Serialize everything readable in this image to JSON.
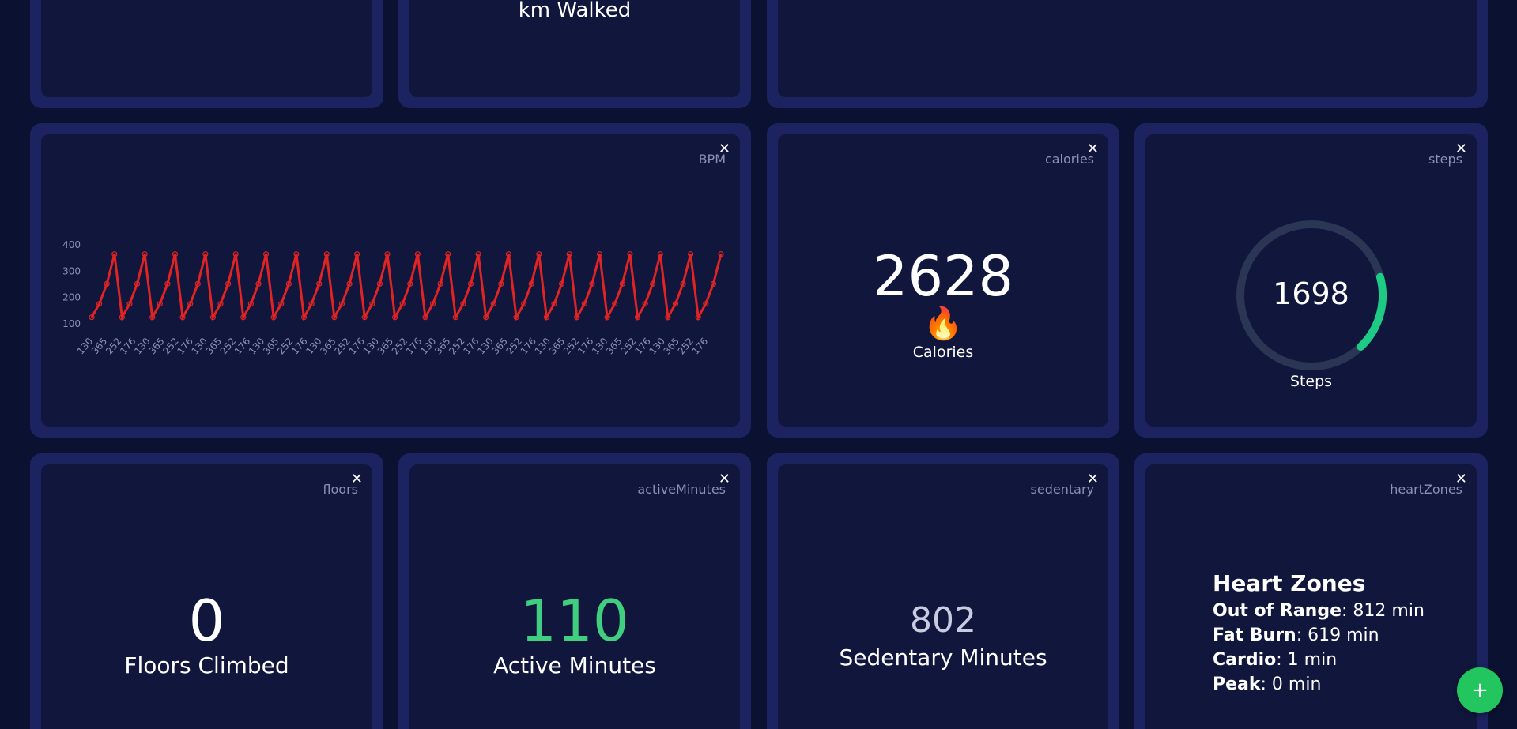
{
  "top_row": {
    "km_label": "km Walked"
  },
  "bpm": {
    "tag": "BPM",
    "close_label": "✕"
  },
  "calories": {
    "tag": "calories",
    "close_label": "✕",
    "value": "2628",
    "emoji": "🔥",
    "label": "Calories"
  },
  "steps": {
    "tag": "steps",
    "close_label": "✕",
    "value": "1698",
    "label": "Steps",
    "progress": 0.17,
    "track_color": "#2b3554",
    "fill_color": "#1ecb84"
  },
  "floors": {
    "tag": "floors",
    "close_label": "✕",
    "value": "0",
    "label": "Floors Climbed"
  },
  "active": {
    "tag": "activeMinutes",
    "close_label": "✕",
    "value": "110",
    "label": "Active Minutes",
    "value_color": "#3fcf7f"
  },
  "sedentary": {
    "tag": "sedentary",
    "close_label": "✕",
    "value": "802",
    "label": "Sedentary Minutes"
  },
  "heartZones": {
    "tag": "heartZones",
    "close_label": "✕",
    "title": "Heart Zones",
    "zones": [
      {
        "name": "Out of Range",
        "value": ": 812 min"
      },
      {
        "name": "Fat Burn",
        "value": ": 619 min"
      },
      {
        "name": "Cardio",
        "value": ": 1 min"
      },
      {
        "name": "Peak",
        "value": ": 0 min"
      }
    ]
  },
  "fab": {
    "label": "+"
  },
  "chart_data": {
    "type": "line",
    "color": "#e02424",
    "yticks": [
      "100",
      "200",
      "300",
      "400"
    ],
    "ylim": [
      100,
      400
    ],
    "x": [
      "130",
      "176",
      "365",
      "252",
      "176",
      "130",
      "176",
      "365",
      "252",
      "176",
      "130",
      "176",
      "365",
      "252",
      "176",
      "130",
      "176",
      "365",
      "252",
      "176",
      "130",
      "176",
      "365",
      "252",
      "176",
      "130",
      "176",
      "365",
      "252",
      "176",
      "130",
      "176",
      "365",
      "252",
      "176",
      "130",
      "176",
      "365",
      "252",
      "176",
      "130",
      "176",
      "365",
      "252",
      "176",
      "130",
      "176",
      "365",
      "252",
      "176",
      "130",
      "176",
      "365",
      "252",
      "176",
      "130",
      "176",
      "365",
      "252",
      "176",
      "130",
      "176",
      "365",
      "252",
      "176",
      "130",
      "176",
      "365",
      "252",
      "176",
      "130",
      "176",
      "365",
      "252",
      "176",
      "130",
      "176",
      "365",
      "252",
      "176",
      "130",
      "176",
      "365",
      "252"
    ],
    "xtick_labels": [
      "130",
      "365",
      "252",
      "176",
      "130",
      "365",
      "252",
      "176",
      "130",
      "365",
      "252",
      "176",
      "130",
      "365",
      "252",
      "176",
      "130",
      "365",
      "252",
      "176",
      "130",
      "365",
      "252",
      "176",
      "130",
      "365",
      "252",
      "176",
      "130",
      "365",
      "252",
      "176",
      "130",
      "365",
      "252",
      "176",
      "130",
      "365",
      "252",
      "176",
      "130",
      "365",
      "252",
      "176"
    ],
    "values": [
      125,
      176,
      252,
      365,
      125,
      176,
      252,
      365,
      125,
      176,
      252,
      365,
      125,
      176,
      252,
      365,
      125,
      176,
      252,
      365,
      125,
      176,
      252,
      365,
      125,
      176,
      252,
      365,
      125,
      176,
      252,
      365,
      125,
      176,
      252,
      365,
      125,
      176,
      252,
      365,
      125,
      176,
      252,
      365,
      125,
      176,
      252,
      365,
      125,
      176,
      252,
      365,
      125,
      176,
      252,
      365,
      125,
      176,
      252,
      365,
      125,
      176,
      252,
      365,
      125,
      176,
      252,
      365,
      125,
      176,
      252,
      365,
      125,
      176,
      252,
      365,
      125,
      176,
      252,
      365,
      125,
      176,
      252,
      365
    ]
  }
}
